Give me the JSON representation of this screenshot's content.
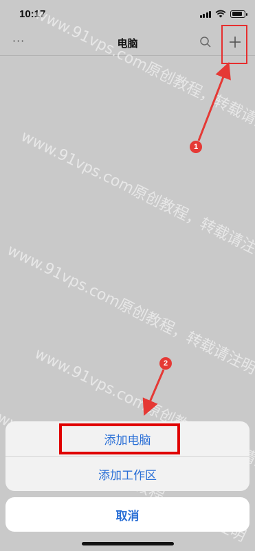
{
  "status_bar": {
    "time": "10:17"
  },
  "nav": {
    "more": "···",
    "title": "电脑"
  },
  "annotations": {
    "badge_1": "1",
    "badge_2": "2"
  },
  "watermark": "www.91vps.com原创教程，转载请注明",
  "action_sheet": {
    "items": [
      "添加电脑",
      "添加工作区"
    ],
    "cancel": "取消"
  },
  "colors": {
    "accent": "#2a6fd6",
    "highlight": "#e00000",
    "badge": "#e53935"
  }
}
